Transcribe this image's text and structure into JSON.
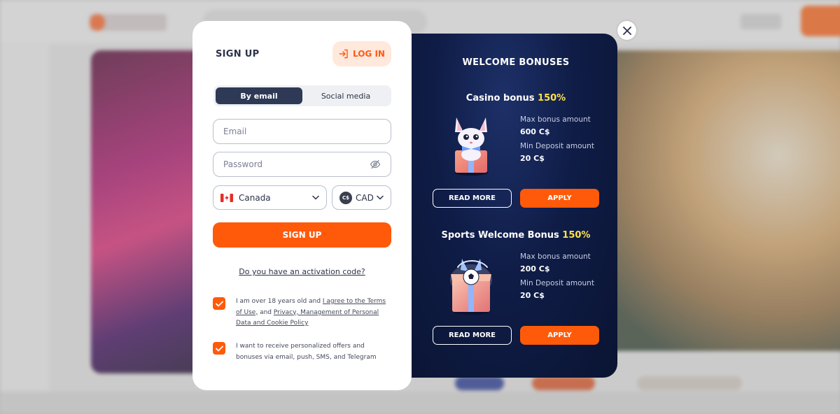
{
  "signup": {
    "title": "SIGN UP",
    "login_label": "LOG IN",
    "tabs": [
      {
        "label": "By email",
        "active": true
      },
      {
        "label": "Social media",
        "active": false
      }
    ],
    "email_placeholder": "Email",
    "password_placeholder": "Password",
    "country": {
      "value": "Canada",
      "flag": "canada-flag-icon"
    },
    "currency": {
      "value": "CAD",
      "symbol": "C$"
    },
    "submit_label": "SIGN UP",
    "activation_link": "Do you have an activation code?",
    "consents": [
      {
        "checked": true,
        "text_before": "I am over 18 years old and ",
        "link1": "I agree to the Terms of Use,",
        "text_middle": " and ",
        "link2": "Privacy, Management of Personal Data and Cookie Policy"
      },
      {
        "checked": true,
        "text": "I want to receive personalized offers and bonuses via email, push, SMS, and Telegram"
      }
    ]
  },
  "bonuses": {
    "title": "WELCOME BONUSES",
    "items": [
      {
        "name": "Casino bonus ",
        "percent": "150%",
        "max_label": "Max bonus amount",
        "max_value": "600 C$",
        "min_label": "Min Deposit amount",
        "min_value": "20 C$",
        "read_more": "READ MORE",
        "apply": "APPLY"
      },
      {
        "name": "Sports Welcome Bonus ",
        "percent": "150%",
        "max_label": "Max bonus amount",
        "max_value": "200 C$",
        "min_label": "Min Deposit amount",
        "min_value": "20 C$",
        "read_more": "READ MORE",
        "apply": "APPLY"
      }
    ]
  },
  "colors": {
    "accent": "#ff5a0a",
    "dark_panel": "#0f1c46",
    "highlight": "#ffe24a"
  }
}
